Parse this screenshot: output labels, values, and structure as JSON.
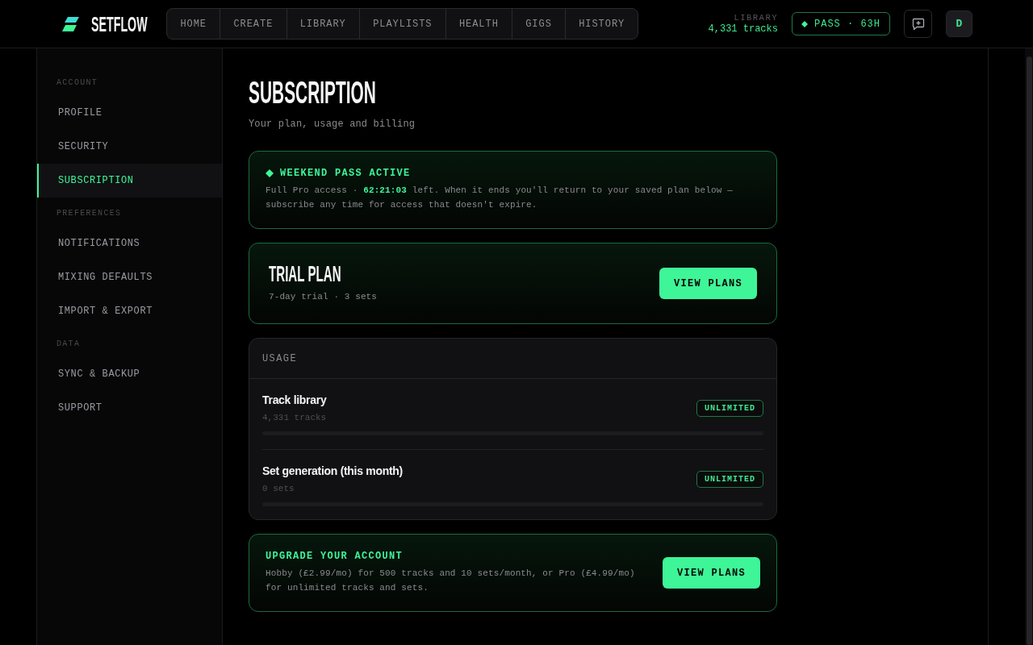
{
  "header": {
    "logo": "SETFLOW",
    "nav": [
      {
        "label": "HOME",
        "selected": false
      },
      {
        "label": "CREATE",
        "selected": false
      },
      {
        "label": "LIBRARY",
        "selected": false
      },
      {
        "label": "PLAYLISTS",
        "selected": false
      },
      {
        "label": "HEALTH",
        "selected": false
      },
      {
        "label": "GIGS",
        "selected": false
      },
      {
        "label": "HISTORY",
        "selected": false
      }
    ],
    "library": {
      "label": "LIBRARY",
      "value": "4,331 tracks"
    },
    "pass": "PASS · 63H",
    "avatar": "D"
  },
  "sidebar": {
    "sections": [
      {
        "heading": "ACCOUNT",
        "items": [
          {
            "label": "PROFILE",
            "selected": false
          },
          {
            "label": "SECURITY",
            "selected": false
          },
          {
            "label": "SUBSCRIPTION",
            "selected": true
          }
        ]
      },
      {
        "heading": "PREFERENCES",
        "items": [
          {
            "label": "NOTIFICATIONS",
            "selected": false
          },
          {
            "label": "MIXING DEFAULTS",
            "selected": false
          },
          {
            "label": "IMPORT & EXPORT",
            "selected": false
          }
        ]
      },
      {
        "heading": "DATA",
        "items": [
          {
            "label": "SYNC & BACKUP",
            "selected": false
          },
          {
            "label": "SUPPORT",
            "selected": false
          }
        ]
      }
    ]
  },
  "page": {
    "title": "SUBSCRIPTION",
    "subtitle": "Your plan, usage and billing"
  },
  "pass_notice": {
    "title": "WEEKEND PASS ACTIVE",
    "text": "Full Pro access · **62:21:03** left. When it ends you'll return to your saved plan below — subscribe any time for access that doesn't expire."
  },
  "plan": {
    "name": "TRIAL PLAN",
    "details": "7-day trial · 3 sets",
    "button": "VIEW PLANS"
  },
  "usage": {
    "heading": "USAGE",
    "rows": [
      {
        "label": "Track library",
        "count": "4,331 tracks",
        "status": "UNLIMITED"
      },
      {
        "label": "Set generation (this month)",
        "count": "0 sets",
        "status": "UNLIMITED"
      }
    ]
  },
  "upgrade": {
    "title": "UPGRADE YOUR ACCOUNT",
    "text": "Hobby (£2.99/mo) for 500 tracks and 10 sets/month, or Pro (£4.99/mo) for unlimited tracks and sets.",
    "button": "VIEW PLANS"
  }
}
